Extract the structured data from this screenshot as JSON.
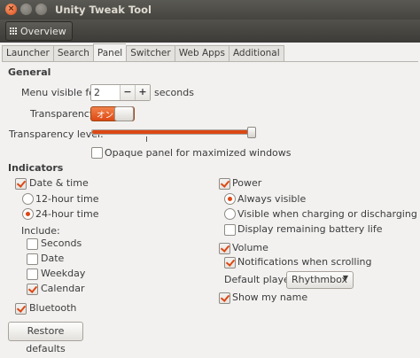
{
  "window": {
    "title": "Unity Tweak Tool",
    "close_glyph": "×"
  },
  "toolbar": {
    "overview_label": "Overview"
  },
  "tabs": [
    "Launcher",
    "Search",
    "Panel",
    "Switcher",
    "Web Apps",
    "Additional"
  ],
  "active_tab": "Panel",
  "general": {
    "heading": "General",
    "menu_visible_label": "Menu visible for:",
    "menu_visible_value": "2",
    "minus": "−",
    "plus": "+",
    "seconds_label": "seconds",
    "transparency_label": "Transparency:",
    "transparency_switch_text": "オン",
    "transparency_on": true,
    "transparency_level_label": "Transparency level:",
    "transparency_level_fraction": 0.97,
    "opaque_label": "Opaque panel for maximized windows",
    "opaque_checked": false
  },
  "indicators": {
    "heading": "Indicators",
    "datetime": {
      "label": "Date & time",
      "checked": true,
      "h12_label": "12-hour time",
      "h24_label": "24-hour time",
      "selected": "24-hour time",
      "include_label": "Include:",
      "seconds_label": "Seconds",
      "seconds_checked": false,
      "date_label": "Date",
      "date_checked": false,
      "weekday_label": "Weekday",
      "weekday_checked": false,
      "calendar_label": "Calendar",
      "calendar_checked": true
    },
    "bluetooth": {
      "label": "Bluetooth",
      "checked": true
    },
    "power": {
      "label": "Power",
      "checked": true,
      "always_label": "Always visible",
      "charging_label": "Visible when charging or discharging",
      "selected": "Always visible",
      "battery_label": "Display remaining battery life",
      "battery_checked": false
    },
    "volume": {
      "label": "Volume",
      "checked": true,
      "notif_label": "Notifications when scrolling",
      "notif_checked": true,
      "player_label": "Default player:",
      "player_value": "Rhythmbox",
      "dropdown_glyph": "▼"
    },
    "show_name": {
      "label": "Show my name",
      "checked": true
    }
  },
  "footer": {
    "restore_label": "Restore defaults"
  },
  "colors": {
    "accent": "#dd4814",
    "titlebar": "#45443f",
    "background": "#f2f1f0"
  }
}
